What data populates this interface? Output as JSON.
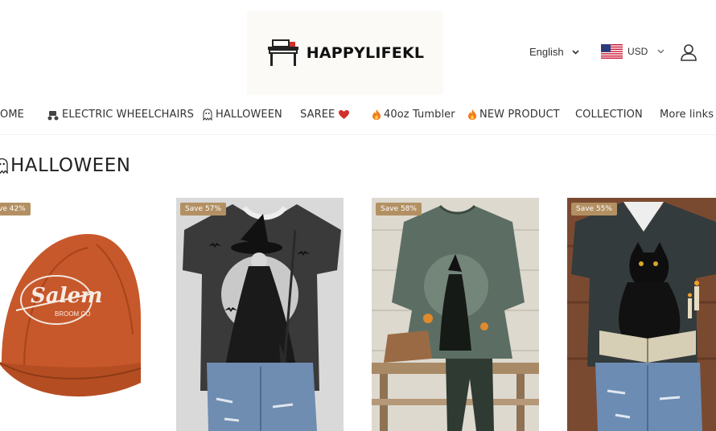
{
  "header": {
    "brand": "HAPPYLIFEKL",
    "language": "English",
    "currency": "USD"
  },
  "nav": {
    "items": [
      {
        "label": "OME",
        "icon": ""
      },
      {
        "label": "ELECTRIC WHEELCHAIRS",
        "icon": "wheelchair-icon"
      },
      {
        "label": "HALLOWEEN",
        "icon": "ghost-icon"
      },
      {
        "label": "SAREE",
        "icon_after": "heart-icon"
      },
      {
        "label": "40oz Tumbler",
        "icon": "fire-icon"
      },
      {
        "label": "NEW PRODUCT",
        "icon": "fire-icon"
      },
      {
        "label": "COLLECTION",
        "icon": ""
      },
      {
        "label": "More links",
        "icon": ""
      }
    ]
  },
  "section": {
    "title": "HALLOWEEN",
    "icon": "ghost-icon"
  },
  "products": [
    {
      "badge": "ve 42%",
      "image": "salem-cap"
    },
    {
      "badge": "Save 57%",
      "image": "witch-tshirt"
    },
    {
      "badge": "Save 58%",
      "image": "green-witch-tunic"
    },
    {
      "badge": "Save 55%",
      "image": "black-cat-tshirt"
    }
  ],
  "colors": {
    "badge": "#b39063",
    "text": "#333333",
    "accent_red": "#d0302b"
  }
}
